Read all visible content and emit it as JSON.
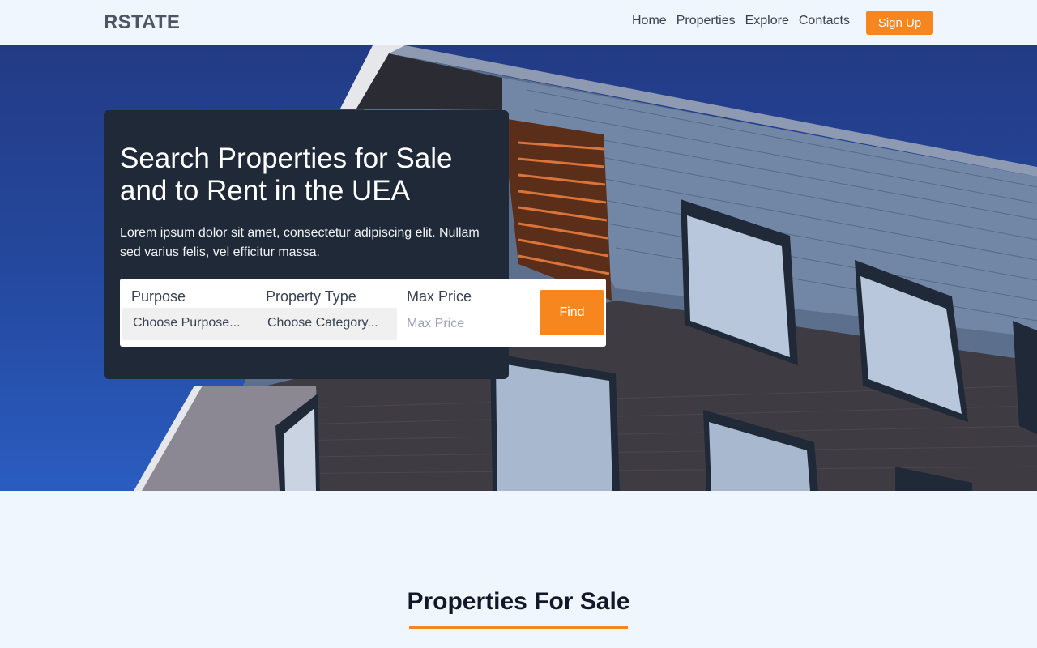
{
  "navbar": {
    "brand": "RSTATE",
    "links": [
      "Home",
      "Properties",
      "Explore",
      "Contacts"
    ],
    "signup_label": "Sign Up"
  },
  "hero": {
    "title": "Search Properties for Sale and to Rent in the UEA",
    "description": "Lorem ipsum dolor sit amet, consectetur adipiscing elit. Nullam sed varius felis, vel efficitur massa.",
    "image": "building-facade-photo"
  },
  "search": {
    "purpose_label": "Purpose",
    "purpose_value": "Choose Purpose...",
    "type_label": "Property Type",
    "type_value": "Choose Category...",
    "price_label": "Max Price",
    "price_placeholder": "Max Price",
    "find_label": "Find"
  },
  "section": {
    "title": "Properties For Sale"
  },
  "colors": {
    "accent": "#f7861e",
    "card": "#1f2937",
    "page_bg": "#f0f6fe",
    "sky": "#2a4fa8"
  }
}
